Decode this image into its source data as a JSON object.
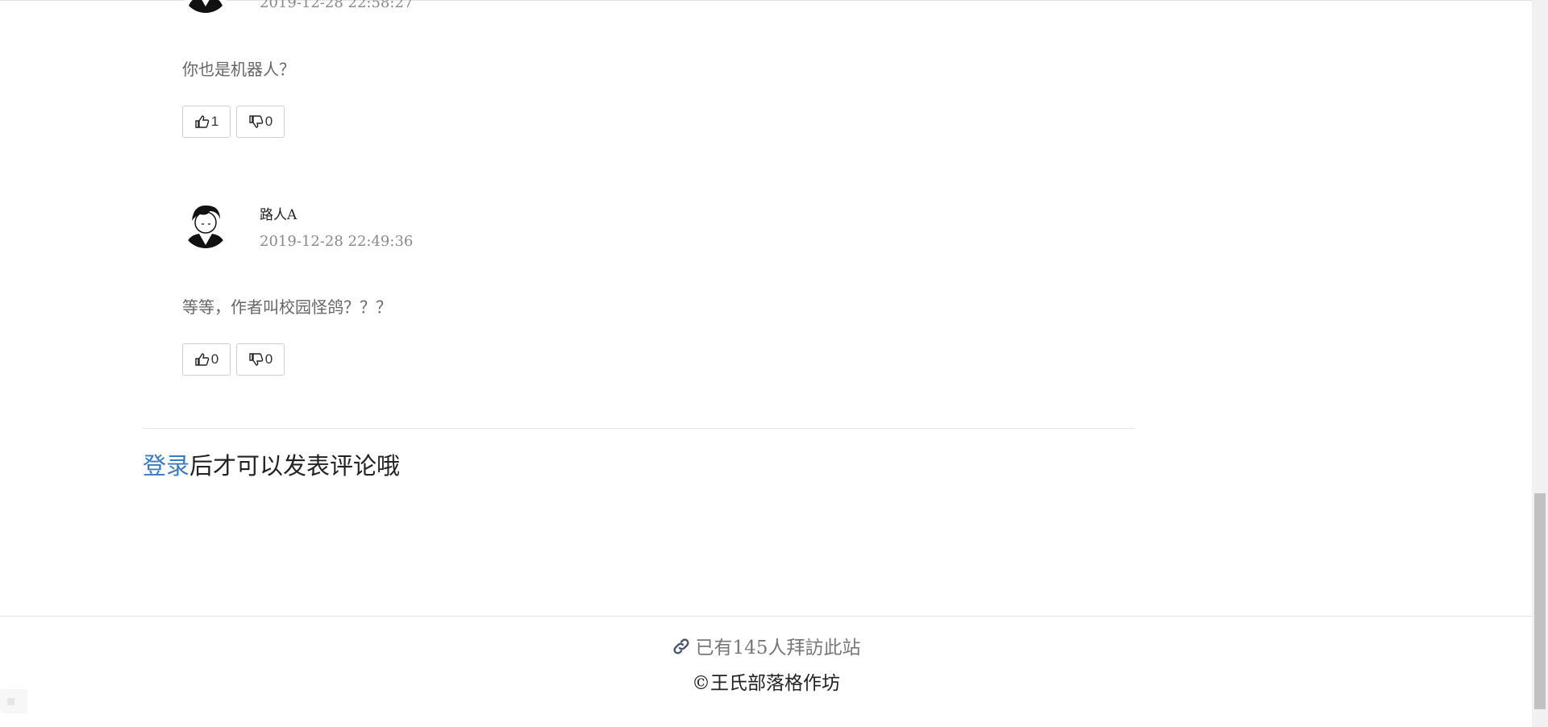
{
  "comments": [
    {
      "author": "",
      "time": "2019-12-28 22:58:27",
      "text": "你也是机器人？",
      "likes": "1",
      "dislikes": "0"
    },
    {
      "author": "路人A",
      "time": "2019-12-28 22:49:36",
      "text": "等等，作者叫校园怪鸽？？？",
      "likes": "0",
      "dislikes": "0"
    }
  ],
  "login_prompt": {
    "link": "登录",
    "rest": "后才可以发表评论哦"
  },
  "footer": {
    "visits": "已有145人拜訪此站",
    "copyright": "©王氏部落格作坊"
  },
  "colors": {
    "link": "#3b7ac0",
    "timestamp": "#8a8a8a"
  },
  "icons": [
    "thumbs-up-icon",
    "thumbs-down-icon",
    "link-icon"
  ]
}
